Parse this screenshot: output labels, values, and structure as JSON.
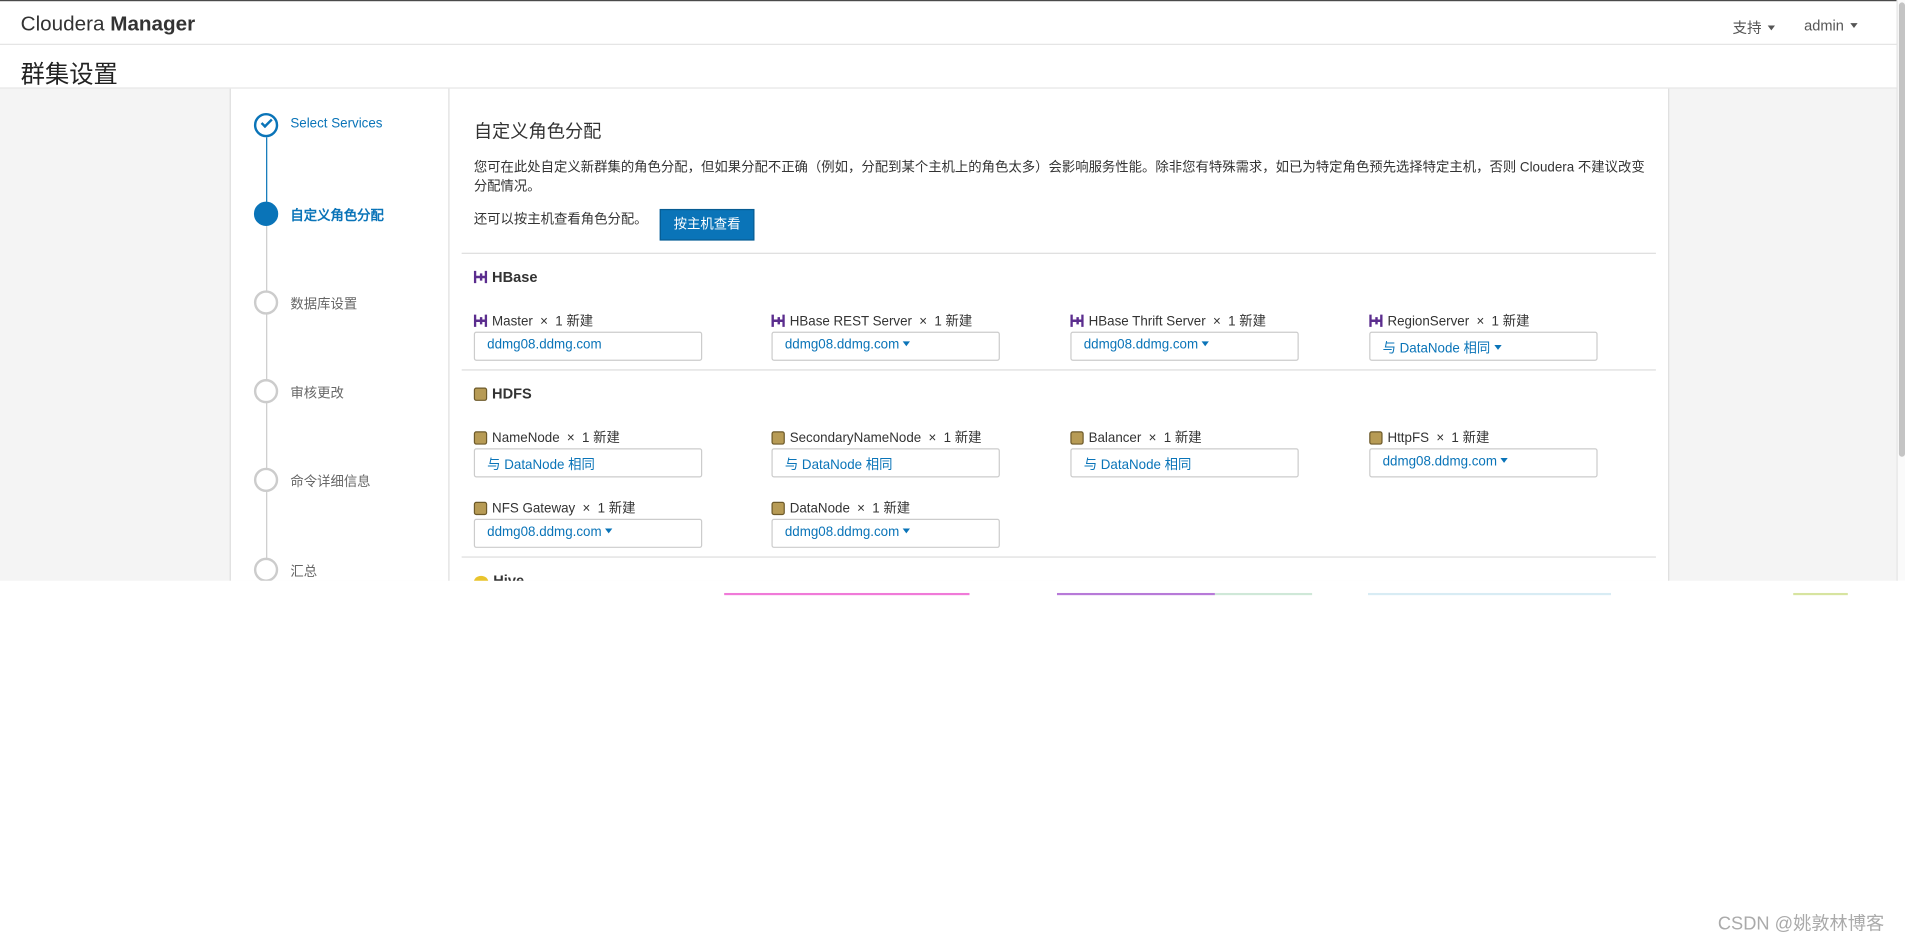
{
  "header": {
    "brand_light": "Cloudera",
    "brand_bold": "Manager",
    "support_label": "支持",
    "user_label": "admin"
  },
  "page_title": "群集设置",
  "steps": [
    {
      "label": "Select Services",
      "state": "done"
    },
    {
      "label": "自定义角色分配",
      "state": "active"
    },
    {
      "label": "数据库设置",
      "state": "pending"
    },
    {
      "label": "审核更改",
      "state": "pending"
    },
    {
      "label": "命令详细信息",
      "state": "pending"
    },
    {
      "label": "汇总",
      "state": "pending"
    }
  ],
  "main": {
    "heading": "自定义角色分配",
    "description": "您可在此处自定义新群集的角色分配，但如果分配不正确（例如，分配到某个主机上的角色太多）会影响服务性能。除非您有特殊需求，如已为特定角色预先选择特定主机，否则 Cloudera 不建议改变分配情况。",
    "host_view_text": "还可以按主机查看角色分配。",
    "host_view_button": "按主机查看"
  },
  "services": {
    "hbase": {
      "name": "HBase",
      "roles": [
        {
          "name": "Master",
          "count": "1 新建",
          "value": "ddmg08.ddmg.com",
          "dropdown": false
        },
        {
          "name": "HBase REST Server",
          "count": "1 新建",
          "value": "ddmg08.ddmg.com",
          "dropdown": true
        },
        {
          "name": "HBase Thrift Server",
          "count": "1 新建",
          "value": "ddmg08.ddmg.com",
          "dropdown": true
        },
        {
          "name": "RegionServer",
          "count": "1 新建",
          "value": "与 DataNode 相同",
          "dropdown": true
        }
      ]
    },
    "hdfs": {
      "name": "HDFS",
      "roles": [
        {
          "name": "NameNode",
          "count": "1 新建",
          "value": "与 DataNode 相同",
          "dropdown": false
        },
        {
          "name": "SecondaryNameNode",
          "count": "1 新建",
          "value": "与 DataNode 相同",
          "dropdown": false
        },
        {
          "name": "Balancer",
          "count": "1 新建",
          "value": "与 DataNode 相同",
          "dropdown": false
        },
        {
          "name": "HttpFS",
          "count": "1 新建",
          "value": "ddmg08.ddmg.com",
          "dropdown": true
        },
        {
          "name": "NFS Gateway",
          "count": "1 新建",
          "value": "ddmg08.ddmg.com",
          "dropdown": true
        },
        {
          "name": "DataNode",
          "count": "1 新建",
          "value": "ddmg08.ddmg.com",
          "dropdown": true
        }
      ]
    },
    "hive": {
      "name": "Hive"
    }
  },
  "role_times": "×",
  "watermark": "CSDN @姚敦林博客",
  "colors": {
    "accent": "#0a74b8",
    "hbase_icon": "#5b2d8e",
    "hdfs_icon": "#b79b55",
    "hive_icon": "#e9c42d"
  }
}
